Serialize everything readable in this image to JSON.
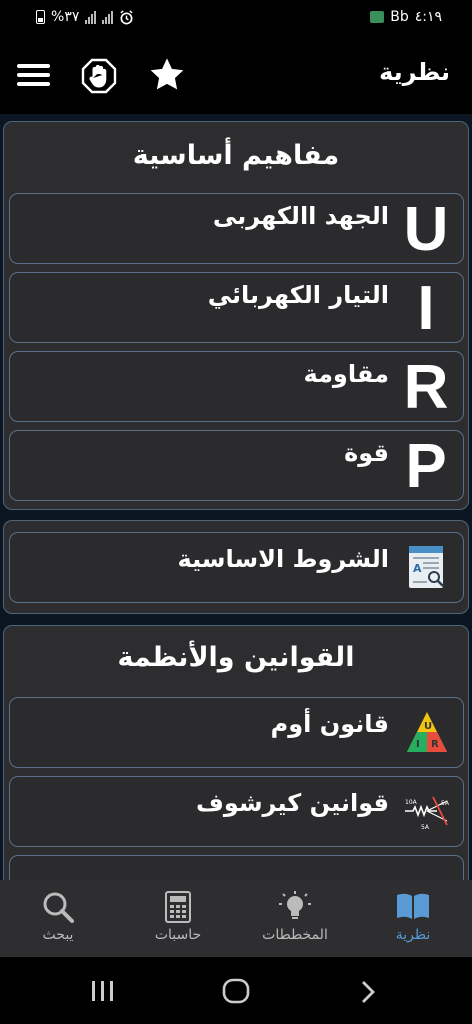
{
  "status_bar": {
    "battery": "%٣٧",
    "carrier": "Bb",
    "time": "٤:١٩"
  },
  "app_bar": {
    "title": "نظرية",
    "menu_icon": "menu-icon",
    "hand_icon": "stop-hand-icon",
    "star_icon": "star-icon"
  },
  "sections": {
    "basics": {
      "title": "مفاهيم أساسية",
      "items": [
        {
          "letter": "U",
          "label": "الجهد االكهربى"
        },
        {
          "letter": "I",
          "label": "التيار الكهربائي"
        },
        {
          "letter": "R",
          "label": "مقاومة"
        },
        {
          "letter": "P",
          "label": "قوة"
        }
      ]
    },
    "conditions": {
      "label": "الشروط الاساسية",
      "icon": "document-search-icon"
    },
    "laws": {
      "title": "القوانين والأنظمة",
      "items": [
        {
          "label": "قانون أوم",
          "icon": "ohm-triangle-icon",
          "icon_letters": [
            "U",
            "I",
            "R"
          ]
        },
        {
          "label": "قوانين كيرشوف",
          "icon": "kirchhoff-icon",
          "icon_labels": [
            "10A",
            "5A",
            "5A"
          ]
        },
        {
          "label": "",
          "icon": "partial-item"
        }
      ]
    }
  },
  "bottom_nav": [
    {
      "label": "نظرية",
      "icon": "book-icon",
      "active": true
    },
    {
      "label": "المخططات",
      "icon": "lightbulb-icon",
      "active": false
    },
    {
      "label": "حاسبات",
      "icon": "calculator-icon",
      "active": false
    },
    {
      "label": "يبحث",
      "icon": "search-icon",
      "active": false
    }
  ],
  "colors": {
    "accent": "#5b9bd5",
    "card_bg": "#2d2d2f",
    "content_bg": "#0c1622",
    "border": "#5a7088"
  }
}
